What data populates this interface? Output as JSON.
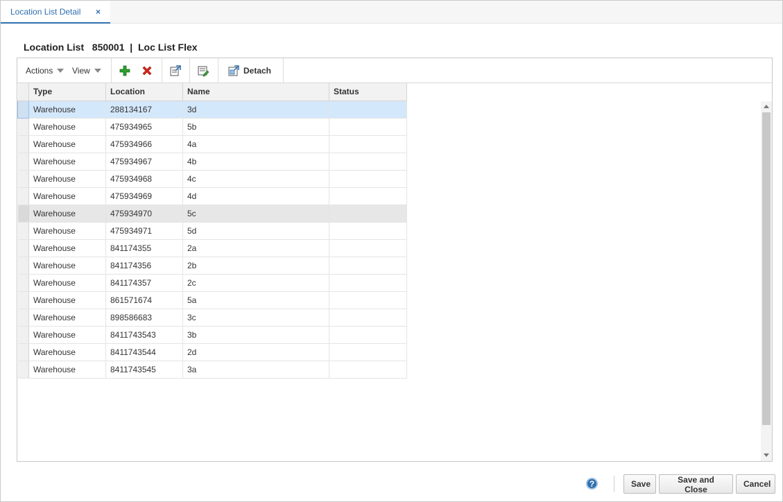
{
  "tab": {
    "label": "Location List Detail",
    "close_glyph": "×"
  },
  "header": {
    "title": "Location List   850001  |  Loc List Flex"
  },
  "toolbar": {
    "actions_label": "Actions",
    "view_label": "View",
    "detach_label": "Detach",
    "icons": [
      "add-icon",
      "delete-icon",
      "export-icon",
      "edit-icon",
      "detach-icon"
    ]
  },
  "table": {
    "columns": [
      "Type",
      "Location",
      "Name",
      "Status"
    ],
    "rows": [
      {
        "type": "Warehouse",
        "location": "288134167",
        "name": "3d",
        "status": ""
      },
      {
        "type": "Warehouse",
        "location": "475934965",
        "name": "5b",
        "status": ""
      },
      {
        "type": "Warehouse",
        "location": "475934966",
        "name": "4a",
        "status": ""
      },
      {
        "type": "Warehouse",
        "location": "475934967",
        "name": "4b",
        "status": ""
      },
      {
        "type": "Warehouse",
        "location": "475934968",
        "name": "4c",
        "status": ""
      },
      {
        "type": "Warehouse",
        "location": "475934969",
        "name": "4d",
        "status": ""
      },
      {
        "type": "Warehouse",
        "location": "475934970",
        "name": "5c",
        "status": ""
      },
      {
        "type": "Warehouse",
        "location": "475934971",
        "name": "5d",
        "status": ""
      },
      {
        "type": "Warehouse",
        "location": "841174355",
        "name": "2a",
        "status": ""
      },
      {
        "type": "Warehouse",
        "location": "841174356",
        "name": "2b",
        "status": ""
      },
      {
        "type": "Warehouse",
        "location": "841174357",
        "name": "2c",
        "status": ""
      },
      {
        "type": "Warehouse",
        "location": "861571674",
        "name": "5a",
        "status": ""
      },
      {
        "type": "Warehouse",
        "location": "898586683",
        "name": "3c",
        "status": ""
      },
      {
        "type": "Warehouse",
        "location": "8411743543",
        "name": "3b",
        "status": ""
      },
      {
        "type": "Warehouse",
        "location": "8411743544",
        "name": "2d",
        "status": ""
      },
      {
        "type": "Warehouse",
        "location": "8411743545",
        "name": "3a",
        "status": ""
      }
    ]
  },
  "footer": {
    "help_glyph": "?",
    "save_label": "Save",
    "save_close_label": "Save and Close",
    "cancel_label": "Cancel"
  },
  "colors": {
    "accent": "#2f6fad",
    "selected_row": "#d4e8fb",
    "add_green": "#2e9e2e",
    "delete_red": "#d6261a"
  }
}
